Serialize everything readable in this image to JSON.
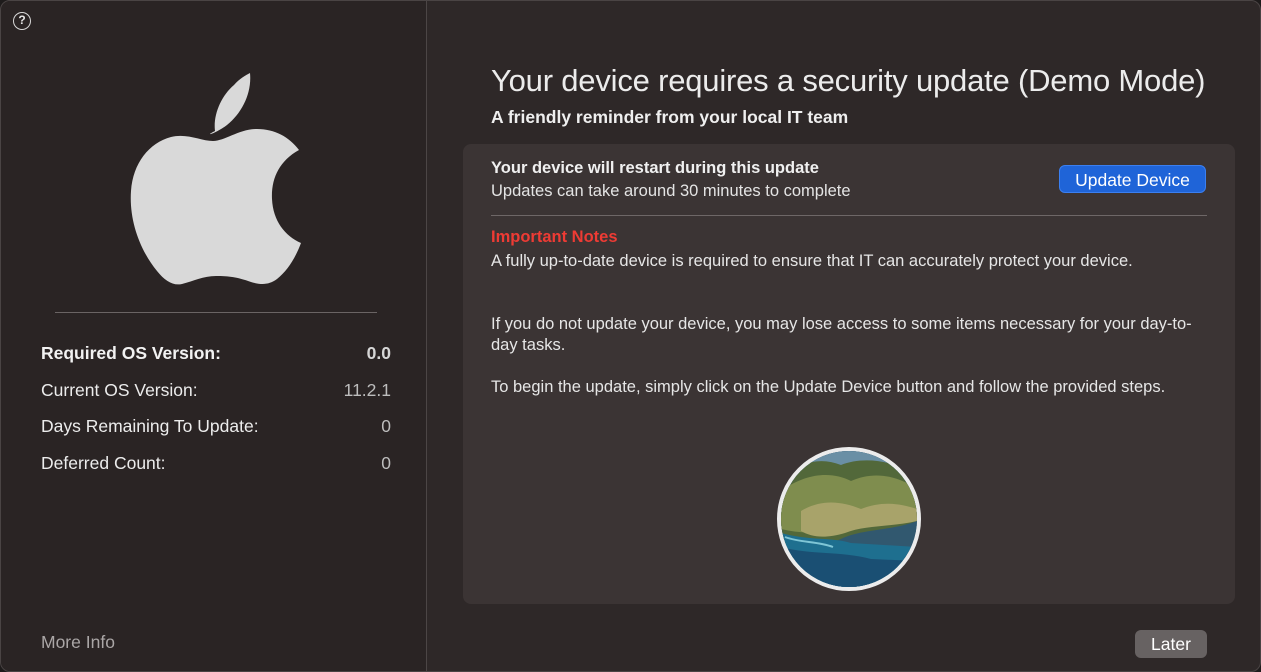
{
  "sidebar": {
    "help_label": "?",
    "rows": [
      {
        "label": "Required OS Version:",
        "value": "0.0"
      },
      {
        "label": "Current OS Version:",
        "value": "11.2.1"
      },
      {
        "label": "Days Remaining To Update:",
        "value": "0"
      },
      {
        "label": "Deferred Count:",
        "value": "0"
      }
    ],
    "more_info": "More Info"
  },
  "main": {
    "title": "Your device requires a security update (Demo Mode)",
    "subtitle": "A friendly reminder from your local IT team",
    "restart_title": "Your device will restart during this update",
    "restart_subtitle": "Updates can take around 30 minutes to complete",
    "update_button": "Update Device",
    "notes_heading": "Important Notes",
    "paragraphs": [
      "A fully up-to-date device is required to ensure that IT can accurately protect your device.",
      "If you do not update your device, you may lose access to some items necessary for your day-to-day tasks.",
      "To begin the update, simply click on the Update Device button and follow the provided steps."
    ],
    "later_button": "Later"
  },
  "icons": {
    "logo": "apple-logo-icon",
    "help": "question-circle-icon",
    "os_image": "macos-big-sur-icon"
  },
  "colors": {
    "accent": "#1f64d8",
    "notes": "#ee3b34",
    "window_bg": "#2e2828",
    "panel_bg": "#3b3434"
  }
}
